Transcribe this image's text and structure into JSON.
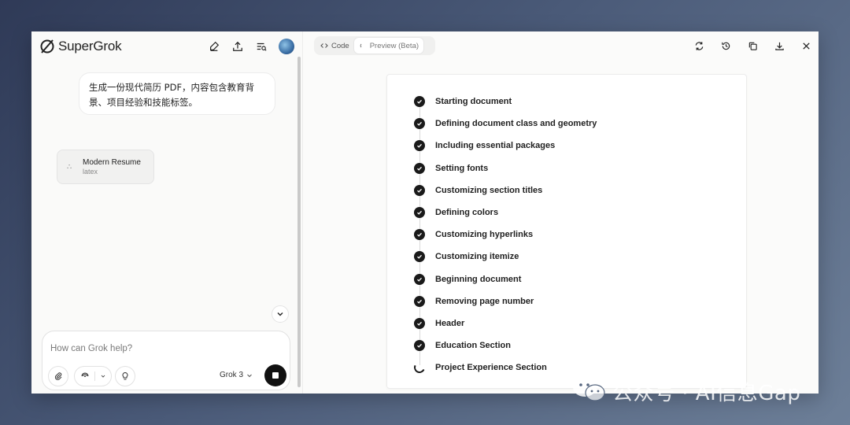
{
  "app": {
    "name": "SuperGrok"
  },
  "chat": {
    "user_message": "生成一份现代简历 PDF，内容包含教育背景、项目经验和技能标签。",
    "artifact": {
      "title": "Modern Resume",
      "type": "latex"
    }
  },
  "composer": {
    "placeholder": "How can Grok help?",
    "model": "Grok 3"
  },
  "viewer": {
    "tabs": [
      {
        "label": "Code",
        "active": false
      },
      {
        "label": "Preview (Beta)",
        "active": true
      }
    ],
    "steps": [
      {
        "label": "Starting document",
        "status": "done"
      },
      {
        "label": "Defining document class and geometry",
        "status": "done"
      },
      {
        "label": "Including essential packages",
        "status": "done"
      },
      {
        "label": "Setting fonts",
        "status": "done"
      },
      {
        "label": "Customizing section titles",
        "status": "done"
      },
      {
        "label": "Defining colors",
        "status": "done"
      },
      {
        "label": "Customizing hyperlinks",
        "status": "done"
      },
      {
        "label": "Customizing itemize",
        "status": "done"
      },
      {
        "label": "Beginning document",
        "status": "done"
      },
      {
        "label": "Removing page number",
        "status": "done"
      },
      {
        "label": "Header",
        "status": "done"
      },
      {
        "label": "Education Section",
        "status": "done"
      },
      {
        "label": "Project Experience Section",
        "status": "in-progress"
      }
    ]
  },
  "watermark": {
    "text": "公众号 · AI信息Gap"
  },
  "icons": {
    "header": [
      "new-chat-icon",
      "share-icon",
      "history-search-icon"
    ],
    "viewer": [
      "refresh-icon",
      "history-icon",
      "copy-icon",
      "download-icon",
      "close-icon"
    ]
  }
}
